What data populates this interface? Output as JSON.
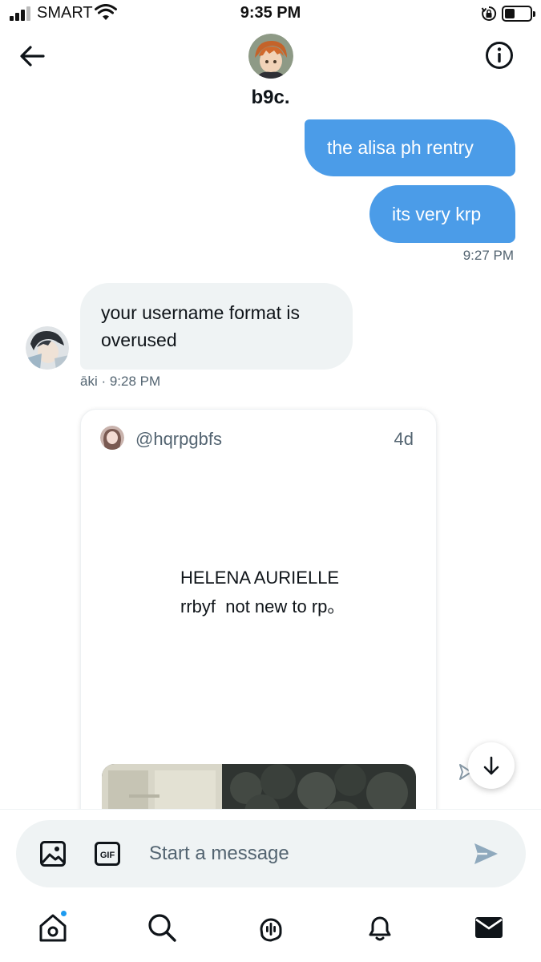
{
  "status_bar": {
    "carrier": "SMART",
    "time": "9:35 PM",
    "battery_level": 0.4,
    "signal_bars": 3
  },
  "header": {
    "contact_name": "b9c.",
    "back_icon": "arrow-left-icon",
    "info_icon": "info-icon"
  },
  "messages": {
    "outgoing": [
      {
        "text": "the alisa ph rentry"
      },
      {
        "text": "its very krp"
      }
    ],
    "outgoing_time": "9:27 PM",
    "incoming": {
      "text": "your username format is overused",
      "meta": "āki · 9:28 PM"
    }
  },
  "shared_tweet": {
    "handle": "@hqrpgbfs",
    "age": "4d",
    "text": "HELENA AURIELLE\nrrbyf  not new to rp。"
  },
  "composer": {
    "placeholder": "Start a message",
    "media_icon": "image-icon",
    "gif_icon": "gif-icon",
    "send_icon": "send-icon"
  },
  "tabs": [
    {
      "name": "home",
      "icon": "home-icon",
      "has_badge": true
    },
    {
      "name": "search",
      "icon": "search-icon"
    },
    {
      "name": "spaces",
      "icon": "microphone-icon"
    },
    {
      "name": "notifications",
      "icon": "bell-icon"
    },
    {
      "name": "messages",
      "icon": "envelope-icon"
    }
  ],
  "colors": {
    "accent": "#1d9bf0",
    "outgoing_bubble": "#4b9ce8",
    "incoming_bubble": "#eff3f4",
    "secondary_text": "#536471"
  }
}
